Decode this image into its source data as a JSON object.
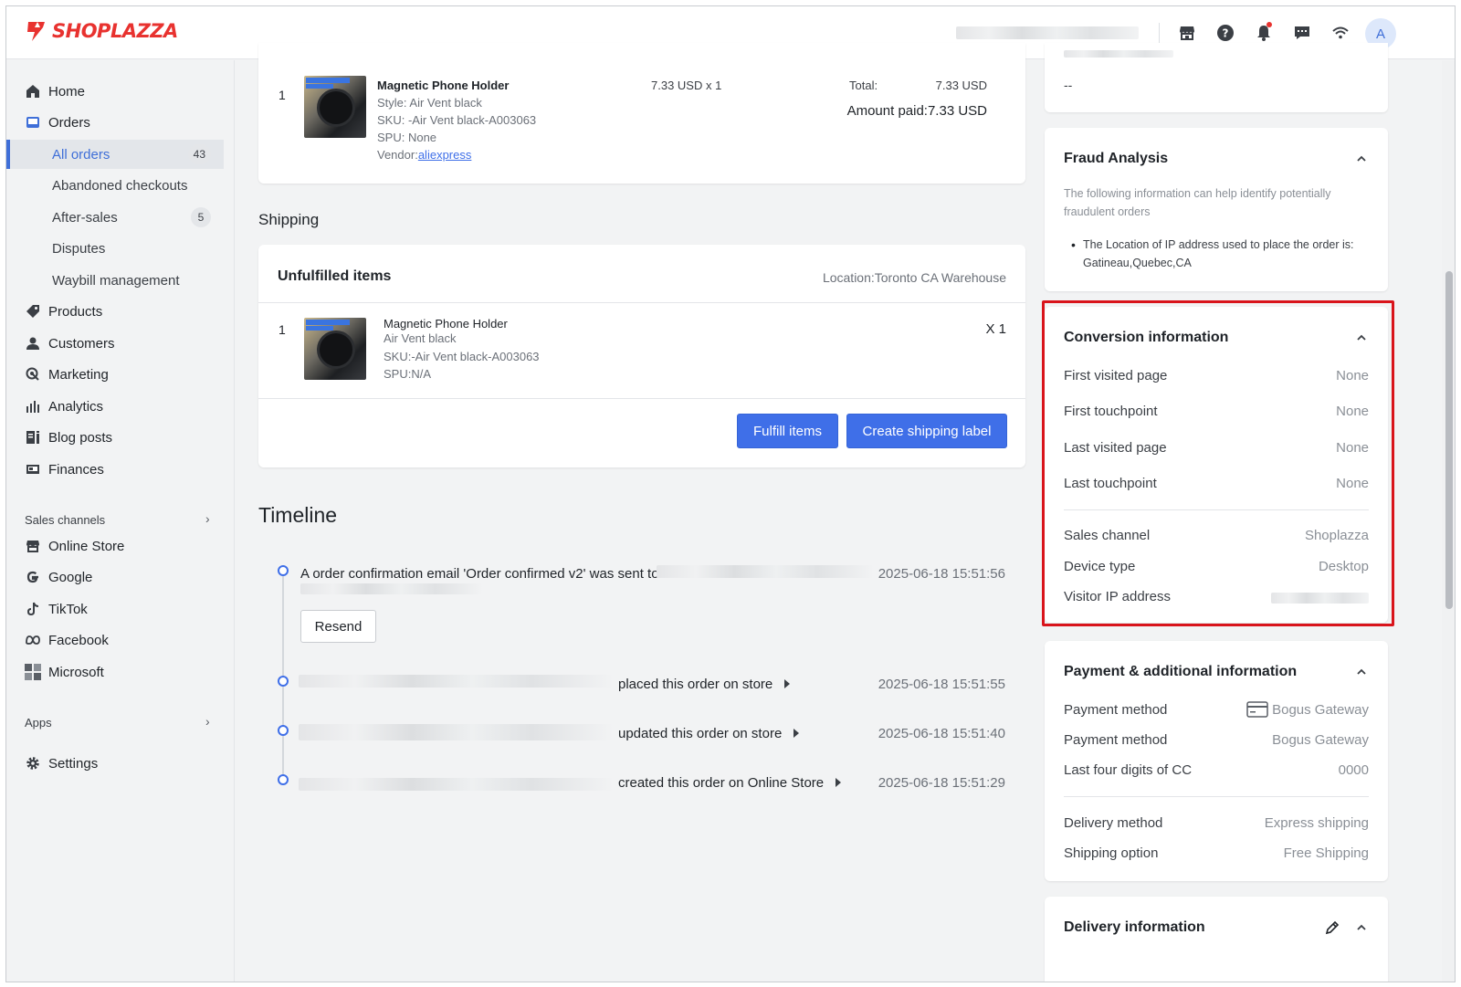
{
  "brand": {
    "name": "SHOPLAZZA",
    "color": "#e8322f"
  },
  "header": {
    "icons": [
      "store-icon",
      "help-icon",
      "bell-icon",
      "chat-icon",
      "wifi-icon"
    ],
    "avatar_initial": "A"
  },
  "sidebar": {
    "items": [
      {
        "label": "Home",
        "icon": "home-icon"
      },
      {
        "label": "Orders",
        "icon": "orders-icon"
      },
      {
        "label": "All orders",
        "badge": "43",
        "active": true
      },
      {
        "label": "Abandoned checkouts"
      },
      {
        "label": "After-sales",
        "badge": "5"
      },
      {
        "label": "Disputes"
      },
      {
        "label": "Waybill management"
      },
      {
        "label": "Products",
        "icon": "tag-icon"
      },
      {
        "label": "Customers",
        "icon": "person-icon"
      },
      {
        "label": "Marketing",
        "icon": "marketing-icon"
      },
      {
        "label": "Analytics",
        "icon": "bar-chart-icon"
      },
      {
        "label": "Blog posts",
        "icon": "blog-icon"
      },
      {
        "label": "Finances",
        "icon": "finance-icon"
      }
    ],
    "sales_channels_title": "Sales channels",
    "channels": [
      {
        "label": "Online Store",
        "icon": "store-icon"
      },
      {
        "label": "Google",
        "icon": "google-icon"
      },
      {
        "label": "TikTok",
        "icon": "tiktok-icon"
      },
      {
        "label": "Facebook",
        "icon": "meta-icon"
      },
      {
        "label": "Microsoft",
        "icon": "microsoft-icon"
      }
    ],
    "apps_title": "Apps",
    "settings_label": "Settings"
  },
  "order_item": {
    "index": "1",
    "name": "Magnetic Phone Holder",
    "style": "Style: Air Vent black",
    "sku": "SKU: -Air Vent black-A003063",
    "spu": "SPU: None",
    "vendor_label": "Vendor:",
    "vendor_link": "aliexpress",
    "price_qty": "7.33 USD x 1",
    "total_label": "Total:",
    "total_value": "7.33 USD",
    "amount_paid": "Amount paid:7.33 USD"
  },
  "shipping": {
    "title": "Shipping",
    "unfulfilled_title": "Unfulfilled items",
    "location": "Location:Toronto CA Warehouse",
    "item": {
      "index": "1",
      "name": "Magnetic Phone Holder",
      "variant": "Air Vent black",
      "sku": "SKU:-Air Vent black-A003063",
      "spu": "SPU:N/A",
      "qty": "X 1"
    },
    "fulfill_button": "Fulfill items",
    "label_button": "Create shipping label"
  },
  "timeline": {
    "title": "Timeline",
    "events": [
      {
        "text": "A order confirmation email 'Order confirmed v2' was sent to",
        "time": "2025-06-18 15:51:56"
      },
      {
        "text": "placed this order on store",
        "time": "2025-06-18 15:51:55"
      },
      {
        "text": "updated this order on store",
        "time": "2025-06-18 15:51:40"
      },
      {
        "text": "created this order on Online Store",
        "time": "2025-06-18 15:51:29"
      }
    ],
    "resend_button": "Resend"
  },
  "right": {
    "top_value": "--",
    "fraud": {
      "title": "Fraud Analysis",
      "desc_line1": "The following information can help identify potentially",
      "desc_line2": "fraudulent orders",
      "bullet_line1": "The Location of IP address used to place the order is:",
      "bullet_line2": "Gatineau,Quebec,CA"
    },
    "conversion": {
      "title": "Conversion information",
      "rows": [
        {
          "label": "First visited page",
          "value": "None"
        },
        {
          "label": "First touchpoint",
          "value": "None"
        },
        {
          "label": "Last visited page",
          "value": "None"
        },
        {
          "label": "Last touchpoint",
          "value": "None"
        }
      ],
      "rows2": [
        {
          "label": "Sales channel",
          "value": "Shoplazza"
        },
        {
          "label": "Device type",
          "value": "Desktop"
        },
        {
          "label": "Visitor IP address",
          "value": ""
        }
      ]
    },
    "payment": {
      "title": "Payment & additional information",
      "rows": [
        {
          "label": "Payment method",
          "value": "Bogus Gateway"
        },
        {
          "label": "Payment method",
          "value": "Bogus Gateway"
        },
        {
          "label": "Last four digits of CC",
          "value": "0000"
        }
      ],
      "rows2": [
        {
          "label": "Delivery method",
          "value": "Express shipping"
        },
        {
          "label": "Shipping option",
          "value": "Free Shipping"
        }
      ]
    },
    "delivery": {
      "title": "Delivery information"
    }
  },
  "colors": {
    "primary": "#3f6fe8",
    "highlight": "#d9141b",
    "active_nav": "#3f6fd8"
  }
}
